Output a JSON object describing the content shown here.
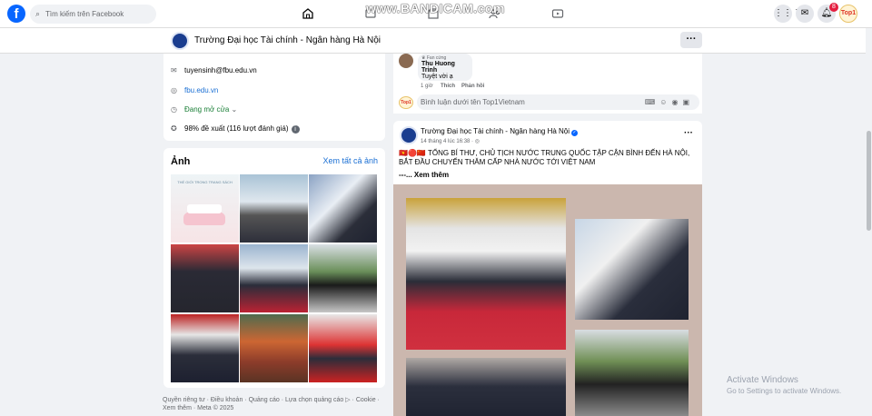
{
  "topbar": {
    "logo": "f",
    "search_placeholder": "Tìm kiếm trên Facebook",
    "watermark": "www.BANDICAM.com",
    "notification_count": "8",
    "profile_label": "Top1"
  },
  "page": {
    "name": "Trường Đại học Tài chính - Ngân hàng Hà Nội",
    "more": "···"
  },
  "intro": {
    "email": "tuyensinh@fbu.edu.vn",
    "website": "fbu.edu.vn",
    "status": "Đang mở cửa",
    "rating": "98% đề xuất (116 lượt đánh giá)"
  },
  "photos": {
    "title": "Ảnh",
    "see_all": "Xem tất cả ảnh",
    "book_title": "THẾ GIỚI TRONG TRANG SÁCH"
  },
  "footer": {
    "text": "Quyền riêng tư · Điều khoản · Quảng cáo · Lựa chọn quảng cáo ▷ · Cookie · Xem thêm · Meta © 2025"
  },
  "comment": {
    "badge": "Fan cứng",
    "author": "Thu Huong Trinh",
    "text": "Tuyệt vời ạ",
    "time": "1 giờ",
    "like": "Thích",
    "reply": "Phản hồi",
    "input_placeholder": "Bình luận dưới tên Top1Vietnam",
    "my_avatar": "Top1"
  },
  "post": {
    "author": "Trường Đại học Tài chính - Ngân hàng Hà Nội",
    "time": "14 tháng 4 lúc 16:38 · ",
    "more": "···",
    "text": "🇻🇳🔴🇨🇳 TỔNG BÍ THƯ, CHỦ TỊCH NƯỚC TRUNG QUỐC TẬP CẬN BÌNH ĐẾN HÀ NỘI, BẮT ĐẦU CHUYẾN THĂM CẤP NHÀ NƯỚC TỚI VIỆT NAM",
    "see_more": "---... Xem thêm"
  },
  "windows": {
    "line1": "Activate Windows",
    "line2": "Go to Settings to activate Windows."
  },
  "colors": {
    "brand": "#0866ff",
    "background": "#f0f2f5",
    "link": "#1a6fd4"
  }
}
